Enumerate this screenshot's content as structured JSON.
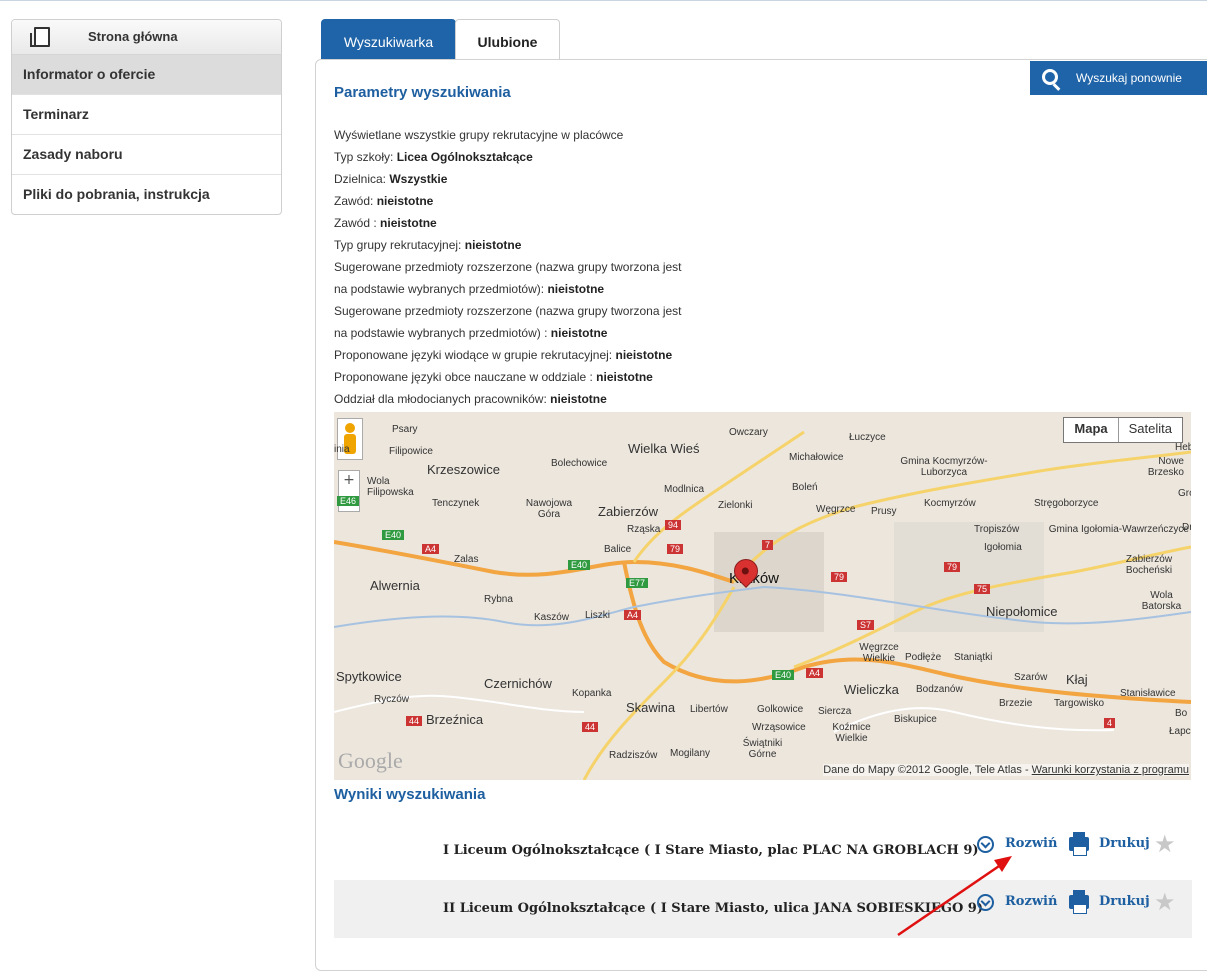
{
  "sidebar": {
    "home_label": "Strona główna",
    "items": [
      {
        "label": "Informator o ofercie"
      },
      {
        "label": "Terminarz"
      },
      {
        "label": "Zasady naboru"
      },
      {
        "label": "Pliki do pobrania, instrukcja"
      }
    ]
  },
  "tabs": [
    {
      "label": "Wyszukiwarka"
    },
    {
      "label": "Ulubione"
    }
  ],
  "search_again_label": "Wyszukaj ponownie",
  "params": {
    "title": "Parametry wyszukiwania",
    "rows": [
      {
        "label": "Wyświetlane wszystkie grupy rekrutacyjne w placówce",
        "value": ""
      },
      {
        "label": "Typ szkoły: ",
        "value": "Licea Ogólnokształcące"
      },
      {
        "label": "Dzielnica: ",
        "value": "Wszystkie"
      },
      {
        "label": "Zawód: ",
        "value": "nieistotne"
      },
      {
        "label": "Zawód : ",
        "value": "nieistotne"
      },
      {
        "label": "Typ grupy rekrutacyjnej: ",
        "value": "nieistotne"
      },
      {
        "label": "Sugerowane przedmioty rozszerzone (nazwa grupy tworzona jest",
        "value": ""
      },
      {
        "label": "na podstawie wybranych przedmiotów): ",
        "value": "nieistotne"
      },
      {
        "label": "Sugerowane przedmioty rozszerzone (nazwa grupy tworzona jest",
        "value": ""
      },
      {
        "label": "na podstawie wybranych przedmiotów) : ",
        "value": "nieistotne"
      },
      {
        "label": "Proponowane języki wiodące w grupie rekrutacyjnej: ",
        "value": "nieistotne"
      },
      {
        "label": "Proponowane języki obce nauczane w oddziale : ",
        "value": "nieistotne"
      },
      {
        "label": "Oddział dla młodocianych pracowników: ",
        "value": "nieistotne"
      }
    ]
  },
  "map": {
    "type_map": "Mapa",
    "type_satellite": "Satelita",
    "zoom_in": "+",
    "zoom_out": "−",
    "logo": "Google",
    "copyright": "Dane do Mapy ©2012 Google, Tele Atlas - ",
    "terms_link": "Warunki korzystania z programu",
    "labels": {
      "krakow": "Kraków",
      "psary": "Psary",
      "owczary": "Owczary",
      "luczyce": "Łuczyce",
      "filipowice": "Filipowice",
      "wielka_wies": "Wielka Wieś",
      "michalowice": "Michałowice",
      "gmina_kocmyrzow": "Gmina Kocmyrzów-Luborzyca",
      "krzeszowice": "Krzeszowice",
      "bolechowice": "Bolechowice",
      "wola_filipowska": "Wola Filipowska",
      "tenczynek": "Tenczynek",
      "nawojowa": "Nawojowa Góra",
      "zabierzow": "Zabierzów",
      "modlnica": "Modlnica",
      "zielonki": "Zielonki",
      "bolen": "Boleń",
      "wegrzce": "Węgrzce",
      "prusy": "Prusy",
      "kocmyrzow": "Kocmyrzów",
      "stregoborzyce": "Stręgoborzyce",
      "rzaska": "Rząska",
      "zalas": "Zalas",
      "balice": "Balice",
      "tropiszow": "Tropiszów",
      "igolomia": "Igołomia",
      "gmina_igolomia": "Gmina Igołomia-Wawrzeńczyce",
      "alwernia": "Alwernia",
      "rybna": "Rybna",
      "kaszow": "Kaszów",
      "liszki": "Liszki",
      "zabierzow_bochenski": "Zabierzów Bocheński",
      "wola_batorska": "Wola Batorska",
      "niepolomice": "Niepołomice",
      "wegrzce_wielkie": "Węgrzce Wielkie",
      "podleze": "Podłęże",
      "staniatki": "Staniątki",
      "spytkowice": "Spytkowice",
      "czernichow": "Czernichów",
      "kopanka": "Kopanka",
      "wieliczka": "Wieliczka",
      "bodzanow": "Bodzanów",
      "szarow": "Szarów",
      "klaj": "Kłaj",
      "stanislawice": "Stanisławice",
      "ryczow": "Ryczów",
      "skawina": "Skawina",
      "libertow": "Libertów",
      "golkowice": "Golkowice",
      "siercza": "Siercza",
      "brzezie": "Brzezie",
      "targowisko": "Targowisko",
      "brzeznica": "Brzeźnica",
      "wrzasowice": "Wrząsowice",
      "kozmice": "Koźmice Wielkie",
      "biskupice": "Biskupice",
      "radziszow": "Radziszów",
      "mogilany": "Mogilany",
      "swiatniki": "Świątniki Górne",
      "nowe_brzesko": "Nowe Brzesko",
      "gro": "Gro",
      "dr": "Dr",
      "bo": "Bo",
      "lapcz": "Łapcz",
      "heb": "Heb",
      "inia": "inia"
    },
    "roads": {
      "e40a": "E40",
      "a4a": "A4",
      "e40b": "E40",
      "e77": "E77",
      "a4b": "A4",
      "r94": "94",
      "r79a": "79",
      "r7": "7",
      "r79b": "79",
      "r79c": "79",
      "r75": "75",
      "s7": "S7",
      "e40c": "E40",
      "a4c": "A4",
      "r44a": "44",
      "r44b": "44",
      "r4": "4",
      "e46": "E46"
    }
  },
  "results": {
    "title": "Wyniki wyszukiwania",
    "items": [
      {
        "name": "I Liceum Ogólnokształcące ( I Stare Miasto, plac PLAC NA GROBLACH 9)",
        "expand": "Rozwiń",
        "print": "Drukuj"
      },
      {
        "name": "II Liceum Ogólnokształcące ( I Stare Miasto, ulica JANA SOBIESKIEGO 9)",
        "expand": "Rozwiń",
        "print": "Drukuj"
      }
    ]
  },
  "colors": {
    "accent": "#1f64a8",
    "annotation_arrow": "#e01010"
  }
}
